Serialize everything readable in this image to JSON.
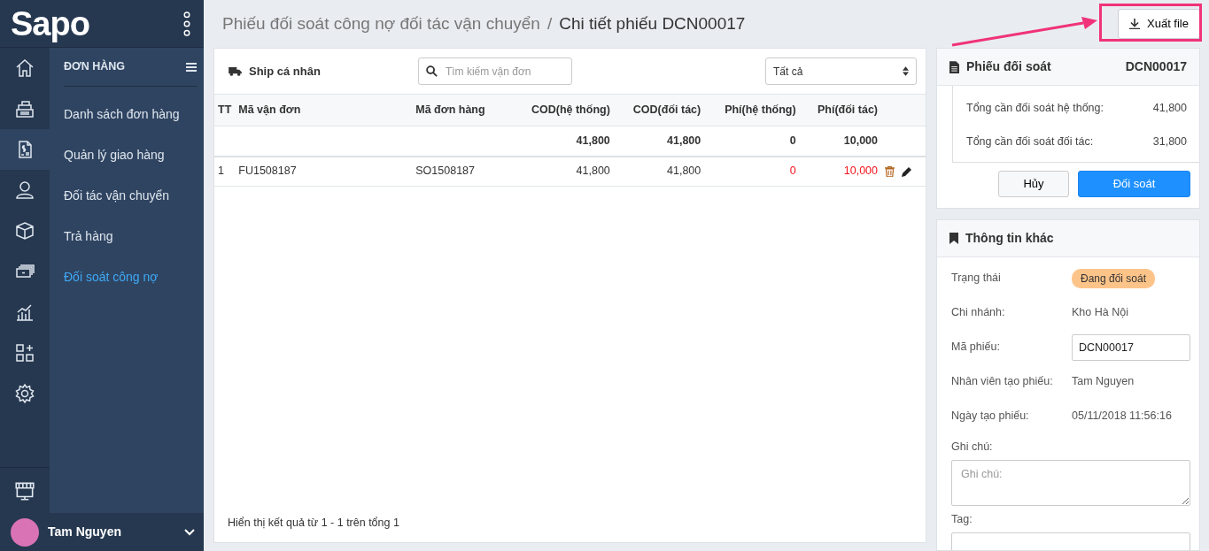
{
  "sidebar": {
    "logo": "Sapo",
    "nav_icons": [
      {
        "kind": "home",
        "selected": false
      },
      {
        "kind": "register",
        "selected": false
      },
      {
        "kind": "invoice",
        "selected": true
      },
      {
        "kind": "user",
        "selected": false
      },
      {
        "kind": "box",
        "selected": false
      },
      {
        "kind": "money",
        "selected": false
      },
      {
        "kind": "chart",
        "selected": false
      },
      {
        "kind": "apps",
        "selected": false
      },
      {
        "kind": "gear",
        "selected": false
      }
    ],
    "bottom_nav": {
      "kind": "store",
      "selected": false
    },
    "submenu_title": "ĐƠN HÀNG",
    "submenu_items": [
      {
        "label": "Danh sách đơn hàng",
        "selected": false
      },
      {
        "label": "Quản lý giao hàng",
        "selected": false
      },
      {
        "label": "Đối tác vận chuyển",
        "selected": false
      },
      {
        "label": "Trả hàng",
        "selected": false
      },
      {
        "label": "Đối soát công nợ",
        "selected": true
      }
    ],
    "user": {
      "name": "Tam Nguyen"
    }
  },
  "breadcrumb": {
    "parent": "Phiếu đối soát công nợ đối tác vận chuyển",
    "separator": "/",
    "current": "Chi tiết phiếu DCN00017"
  },
  "export_button": "Xuất file",
  "annotation": {
    "kind": "callout"
  },
  "orders_card": {
    "carrier": "Ship cá nhân",
    "search": {
      "placeholder": "Tìm kiếm vận đơn"
    },
    "filter": "Tất cả",
    "columns": [
      "TT",
      "Mã vận đơn",
      "Mã đơn hàng",
      "COD(hệ thống)",
      "COD(đối tác)",
      "Phí(hệ thống)",
      "Phí(đối tác)"
    ],
    "totals": [
      "41,800",
      "41,800",
      "0",
      "10,000"
    ],
    "rows": [
      {
        "cells": [
          {
            "text": "1",
            "alert": false
          },
          {
            "text": "FU1508187",
            "alert": false
          },
          {
            "text": "SO1508187",
            "alert": false
          },
          {
            "text": "41,800",
            "alert": false
          },
          {
            "text": "41,800",
            "alert": false
          },
          {
            "text": "0",
            "alert": true
          },
          {
            "text": "10,000",
            "alert": true
          }
        ]
      }
    ],
    "footer": "Hiển thị kết quả từ 1 - 1 trên tổng 1"
  },
  "voucher_card": {
    "title": "Phiếu đối soát",
    "code": "DCN00017",
    "summary": [
      {
        "label": "Tổng cần đối soát hệ thống:",
        "value": "41,800"
      },
      {
        "label": "Tổng cần đối soát đối tác:",
        "value": "31,800"
      }
    ],
    "cancel_button": "Hủy",
    "confirm_button": "Đối soát"
  },
  "info_card": {
    "title": "Thông tin khác",
    "fields": [
      {
        "kind": "badge",
        "label": "Trạng thái",
        "value": "Đang đối soát"
      },
      {
        "kind": "text",
        "label": "Chi nhánh:",
        "value": "Kho Hà Nội"
      },
      {
        "kind": "input",
        "label": "Mã phiếu:",
        "value": "DCN00017"
      },
      {
        "kind": "text",
        "label": "Nhân viên tạo phiếu:",
        "value": "Tam Nguyen"
      },
      {
        "kind": "text",
        "label": "Ngày tạo phiếu:",
        "value": "05/11/2018 11:56:16"
      },
      {
        "kind": "textarea",
        "label": "Ghi chú:",
        "placeholder": "Ghi chú:"
      },
      {
        "kind": "input",
        "label": "Tag:"
      }
    ]
  }
}
